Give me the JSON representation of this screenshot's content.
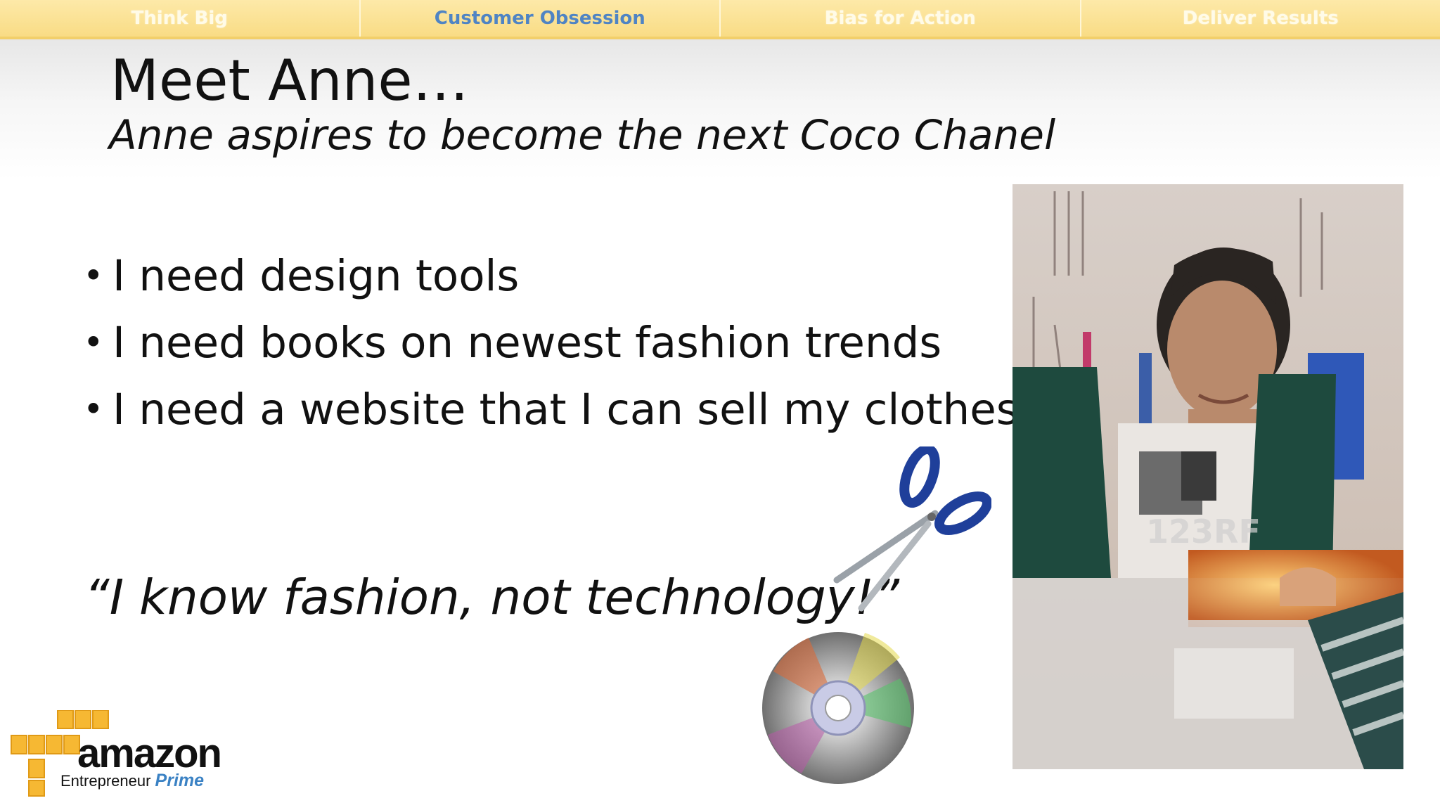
{
  "tabs": [
    {
      "label": "Think Big",
      "active": false
    },
    {
      "label": "Customer Obsession",
      "active": true
    },
    {
      "label": "Bias for Action",
      "active": false
    },
    {
      "label": "Deliver Results",
      "active": false
    }
  ],
  "slide": {
    "title": "Meet Anne…",
    "subtitle": "Anne aspires to become the next Coco Chanel",
    "bullets": [
      "I need design tools",
      "I need books on newest fashion trends",
      "I need a website that I can sell my clothes on"
    ],
    "bullet_glyph": "•",
    "quote": "“I know fashion, not technology!”"
  },
  "logo": {
    "word": "amazon",
    "tagline": "Entrepreneur",
    "tagline_accent": "Prime"
  },
  "photo": {
    "watermark": "123RF"
  },
  "colors": {
    "tab_bg": "#fbe6a0",
    "tab_active_text": "#4f84c4",
    "logo_boxes": "#f6b833",
    "prime_blue": "#3b82c4"
  }
}
